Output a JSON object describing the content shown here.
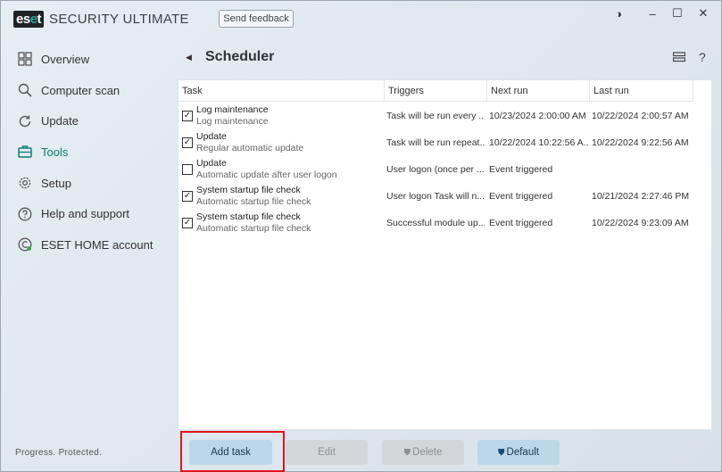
{
  "header": {
    "logo_text": "eset",
    "product": "SECURITY ULTIMATE",
    "feedback_label": "Send feedback"
  },
  "window_controls": {
    "theme": "◑",
    "minimize": "–",
    "maximize": "☐",
    "close": "✕"
  },
  "sidebar": {
    "items": [
      {
        "label": "Overview",
        "icon": "overview-icon"
      },
      {
        "label": "Computer scan",
        "icon": "search-icon"
      },
      {
        "label": "Update",
        "icon": "update-icon"
      },
      {
        "label": "Tools",
        "icon": "tools-icon",
        "active": true
      },
      {
        "label": "Setup",
        "icon": "gear-icon"
      },
      {
        "label": "Help and support",
        "icon": "help-icon"
      },
      {
        "label": "ESET HOME account",
        "icon": "eset-home-icon"
      }
    ],
    "footer": "Progress. Protected."
  },
  "page": {
    "title": "Scheduler",
    "back": "◀",
    "help": "?"
  },
  "table": {
    "columns": [
      "Task",
      "Triggers",
      "Next run",
      "Last run"
    ],
    "rows": [
      {
        "checked": true,
        "name": "Log maintenance",
        "sub": "Log maintenance",
        "trigger": "Task will be run every ...",
        "next": "10/23/2024 2:00:00 AM",
        "last": "10/22/2024 2:00:57 AM"
      },
      {
        "checked": true,
        "name": "Update",
        "sub": "Regular automatic update",
        "trigger": "Task will be run repeat...",
        "next": "10/22/2024 10:22:56 A...",
        "last": "10/22/2024 9:22:56 AM"
      },
      {
        "checked": false,
        "name": "Update",
        "sub": "Automatic update after user logon",
        "trigger": "User logon (once per ...",
        "next": "Event triggered",
        "last": ""
      },
      {
        "checked": true,
        "name": "System startup file check",
        "sub": "Automatic startup file check",
        "trigger": "User logon Task will n...",
        "next": "Event triggered",
        "last": "10/21/2024 2:27:46 PM"
      },
      {
        "checked": true,
        "name": "System startup file check",
        "sub": "Automatic startup file check",
        "trigger": "Successful module up...",
        "next": "Event triggered",
        "last": "10/22/2024 9:23:09 AM"
      }
    ]
  },
  "buttons": {
    "add": "Add task",
    "edit": "Edit",
    "delete": "Delete",
    "default": "Default"
  },
  "colors": {
    "accent": "#0d7d74",
    "highlight": "#e0141e",
    "primary_button": "#bcd8e8"
  }
}
